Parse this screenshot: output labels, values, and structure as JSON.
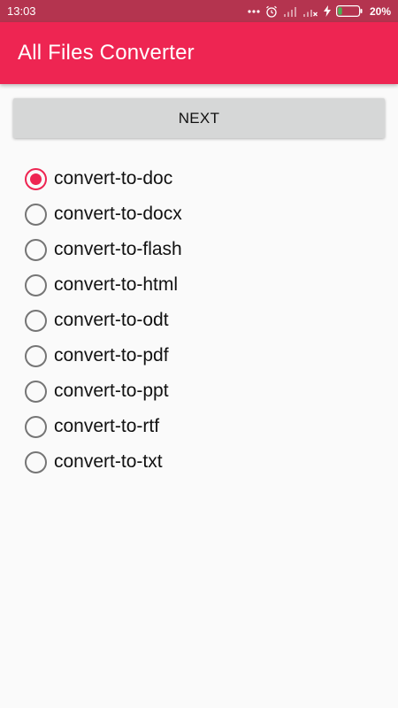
{
  "colors": {
    "status_bar": "#b4344f",
    "app_bar": "#ee2552",
    "accent": "#ee2552",
    "button_bg": "#d6d7d7",
    "background": "#fafafa",
    "battery_fill": "#4caf50"
  },
  "status_bar": {
    "time": "13:03",
    "battery_percent": "20%",
    "battery_level": 0.2,
    "icons": [
      "more-icon",
      "alarm-icon",
      "signal-icon",
      "signal-off-icon",
      "charging-icon",
      "battery-icon"
    ]
  },
  "app_bar": {
    "title": "All Files Converter"
  },
  "next_button": {
    "label": "NEXT"
  },
  "options": {
    "selected_index": 0,
    "items": [
      {
        "label": "convert-to-doc",
        "checked": true
      },
      {
        "label": "convert-to-docx",
        "checked": false
      },
      {
        "label": "convert-to-flash",
        "checked": false
      },
      {
        "label": "convert-to-html",
        "checked": false
      },
      {
        "label": "convert-to-odt",
        "checked": false
      },
      {
        "label": "convert-to-pdf",
        "checked": false
      },
      {
        "label": "convert-to-ppt",
        "checked": false
      },
      {
        "label": "convert-to-rtf",
        "checked": false
      },
      {
        "label": "convert-to-txt",
        "checked": false
      }
    ]
  }
}
